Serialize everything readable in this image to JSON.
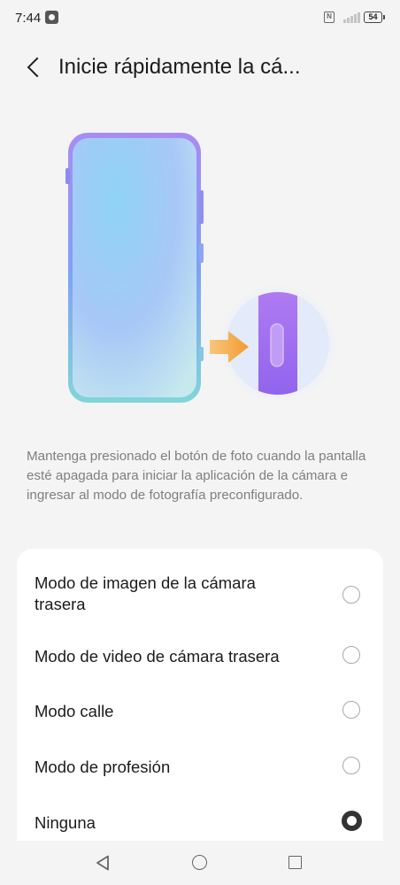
{
  "status_bar": {
    "time": "7:44",
    "battery": "54",
    "nfc": "N"
  },
  "header": {
    "title": "Inicie rápidamente la cá..."
  },
  "illustration": {
    "icon": "phone-camera-button-illustration",
    "arrow_color": "#f5a742",
    "button_color": "#a067f0"
  },
  "description": "Mantenga presionado el botón de foto cuando la pantalla esté apagada para iniciar la aplicación de la cámara e ingresar al modo de fotografía preconfigurado.",
  "options": [
    {
      "label": "Modo de imagen de la cámara trasera",
      "selected": false
    },
    {
      "label": "Modo de video de cámara trasera",
      "selected": false
    },
    {
      "label": "Modo calle",
      "selected": false
    },
    {
      "label": "Modo de profesión",
      "selected": false
    },
    {
      "label": "Ninguna",
      "selected": true
    }
  ],
  "colors": {
    "background": "#f4f4f4",
    "card": "#ffffff",
    "radio_selected": "#333333"
  }
}
